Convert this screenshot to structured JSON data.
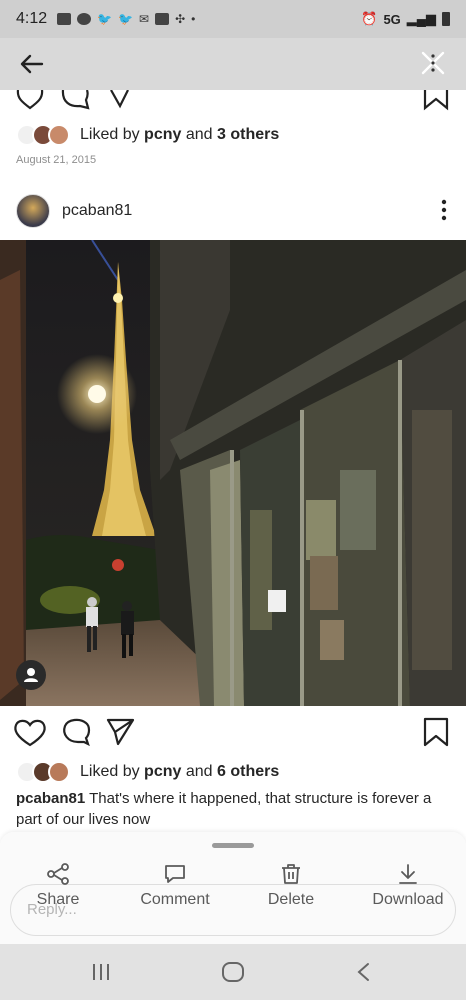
{
  "status_bar": {
    "time": "4:12",
    "network": "5G"
  },
  "post_previous": {
    "likes_prefix": "Liked by",
    "liked_user": "pcny",
    "likes_joiner": "and",
    "likes_others": "3 others",
    "date": "August 21, 2015"
  },
  "post": {
    "username": "pcaban81",
    "likes_prefix": "Liked by",
    "liked_user": "pcny",
    "likes_joiner": "and",
    "likes_others": "6 others",
    "caption_user": "pcaban81",
    "caption_text": "That's where it happened, that structure is forever a part of our lives now"
  },
  "sheet": {
    "reply_placeholder": "Reply...",
    "actions": [
      {
        "label": "Share",
        "icon": "share-icon"
      },
      {
        "label": "Comment",
        "icon": "comment-icon"
      },
      {
        "label": "Delete",
        "icon": "trash-icon"
      },
      {
        "label": "Download",
        "icon": "download-icon"
      }
    ]
  }
}
